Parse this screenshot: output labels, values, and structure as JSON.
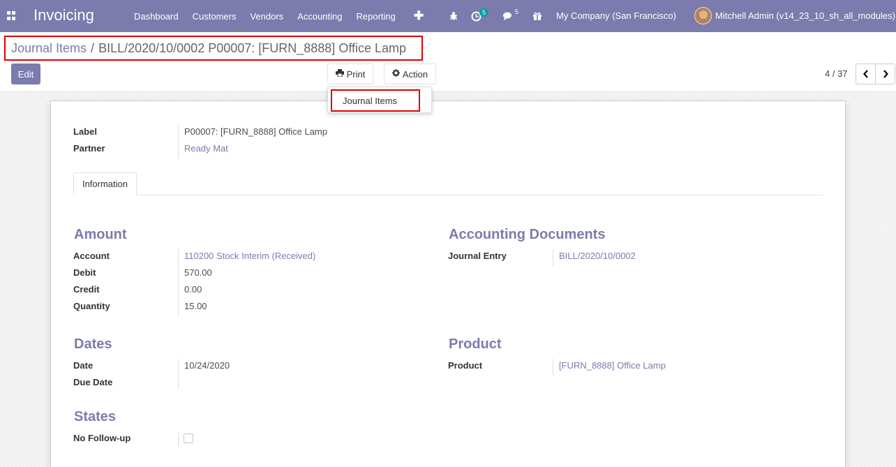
{
  "navbar": {
    "app_title": "Invoicing",
    "menu": [
      "Dashboard",
      "Customers",
      "Vendors",
      "Accounting",
      "Reporting"
    ],
    "activity_count": "5",
    "messages_count": "5",
    "company": "My Company (San Francisco)",
    "user": "Mitchell Admin (v14_23_10_sh_all_modules)",
    "icons": {
      "apps": "apps-grid-icon",
      "plus": "plus-icon",
      "bug": "bug-icon",
      "activity": "clock-icon",
      "chat": "comments-icon",
      "gift": "gift-icon"
    },
    "bg_color": "#7c7bad"
  },
  "breadcrumb": {
    "parent": "Journal Items",
    "separator": "/",
    "current": "BILL/2020/10/0002 P00007: [FURN_8888] Office Lamp"
  },
  "buttons": {
    "edit": "Edit",
    "print": "Print",
    "action": "Action"
  },
  "print_dropdown": {
    "items": [
      "Journal Items"
    ]
  },
  "pager": {
    "value": "4 / 37",
    "prev": "‹",
    "next": "›"
  },
  "form": {
    "header_fields": [
      {
        "label": "Label",
        "value": "P00007: [FURN_8888] Office Lamp"
      },
      {
        "label": "Partner",
        "value": "Ready Mat"
      }
    ],
    "tabs": [
      "Information"
    ],
    "amount": {
      "title": "Amount",
      "fields": [
        {
          "label": "Account",
          "value": "110200 Stock Interim (Received)"
        },
        {
          "label": "Debit",
          "value": "570.00"
        },
        {
          "label": "Credit",
          "value": "0.00"
        },
        {
          "label": "Quantity",
          "value": "15.00"
        }
      ]
    },
    "accounting_documents": {
      "title": "Accounting Documents",
      "fields": [
        {
          "label": "Journal Entry",
          "value": "BILL/2020/10/0002"
        }
      ]
    },
    "dates": {
      "title": "Dates",
      "fields": [
        {
          "label": "Date",
          "value": "10/24/2020"
        },
        {
          "label": "Due Date",
          "value": ""
        }
      ]
    },
    "product": {
      "title": "Product",
      "fields": [
        {
          "label": "Product",
          "value": "[FURN_8888] Office Lamp"
        }
      ]
    },
    "states": {
      "title": "States",
      "fields": [
        {
          "label": "No Follow-up",
          "checked": false
        }
      ]
    }
  }
}
